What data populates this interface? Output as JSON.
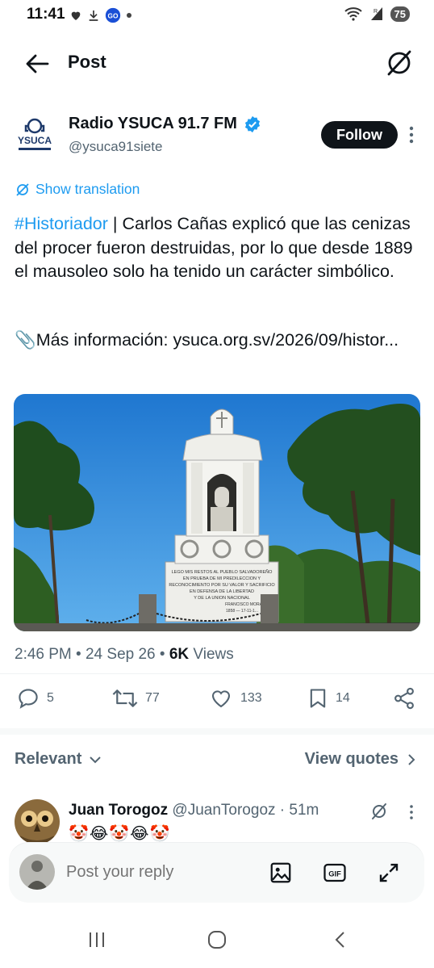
{
  "status_bar": {
    "time": "11:41",
    "battery": "75"
  },
  "header": {
    "title": "Post"
  },
  "post": {
    "author_name": "Radio YSUCA 91.7 FM",
    "author_handle": "@ysuca91siete",
    "follow_label": "Follow",
    "show_translation": "Show translation",
    "hashtag": "#Historiador",
    "body": " | Carlos Cañas explicó que las cenizas del procer fueron destruidas, por lo que desde 1889 el mausoleo solo ha tenido un carácter simbólico.",
    "more_info_label": "📎Más información: ",
    "more_info_link": "ysuca.org.sv/2026/09/histor...",
    "image": {
      "inscription_1": "LEGO MIS RESTOS AL PUEBLO SALVADOREÑO",
      "inscription_2": "EN PRUEBA DE MI PREDILECCION Y",
      "inscription_3": "RECONOCIMIENTO POR SU VALOR Y SACRIFICIO",
      "inscription_4": "EN DEFENSA DE LA LIBERTAD",
      "inscription_5": "Y DE LA UNION NACIONAL",
      "inscription_6": "FRANCISCO MORAZAN",
      "inscription_7": "1858 — 17-11-1..."
    },
    "time": "2:46 PM",
    "date": "24 Sep 26",
    "views_count": "6K",
    "views_label": " Views",
    "replies": "5",
    "reposts": "77",
    "likes": "133",
    "bookmarks": "14"
  },
  "sort": {
    "relevant_label": "Relevant",
    "view_quotes_label": "View quotes"
  },
  "reply": {
    "name": "Juan Torogoz",
    "handle": "@JuanTorogoz",
    "time": " · 51m",
    "text": "🤡😂🤡😂🤡"
  },
  "composer": {
    "placeholder": "Post your reply"
  },
  "colors": {
    "accent": "#1d9bf0",
    "text": "#0f1419",
    "muted": "#536471"
  }
}
